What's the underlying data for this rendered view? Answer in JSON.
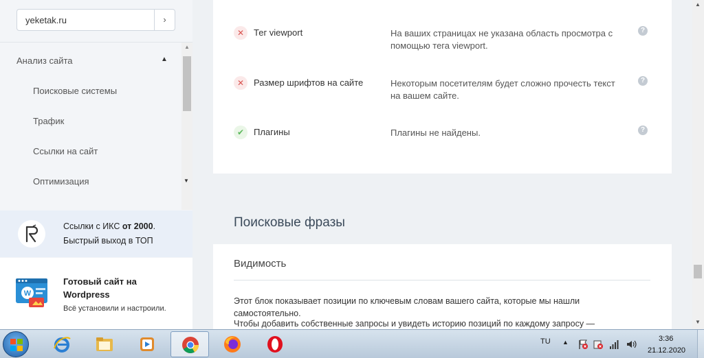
{
  "sidebar": {
    "site": "yeketak.ru",
    "go_symbol": "›",
    "nav": {
      "header": "Анализ сайта",
      "items": [
        "Поисковые системы",
        "Трафик",
        "Ссылки на сайт",
        "Оптимизация"
      ]
    },
    "promo1": {
      "line1_prefix": "Ссылки с ИКС ",
      "line1_strong": "от 2000",
      "line1_suffix": ".",
      "line2": "Быстрый выход в ТОП"
    },
    "promo2": {
      "title1": "Готовый сайт на",
      "title2": "Wordpress",
      "desc": "Всё установили и настроили."
    }
  },
  "checks": [
    {
      "status": "bad",
      "name": "Тег viewport",
      "desc": "На ваших страницах не указана область просмотра с помощью тега viewport."
    },
    {
      "status": "bad",
      "name": "Размер шрифтов на сайте",
      "desc": "Некоторым посетителям будет сложно прочесть текст на вашем сайте."
    },
    {
      "status": "ok",
      "name": "Плагины",
      "desc": "Плагины не найдены."
    }
  ],
  "search_phrases": {
    "title": "Поисковые фразы",
    "subtitle": "Видимость",
    "para1": "Этот блок показывает позиции по ключевым словам вашего сайта, которые мы нашли самостоятельно.",
    "para2": "Чтобы добавить собственные запросы и увидеть историю позиций по каждому запросу —"
  },
  "taskbar": {
    "lang": "TU",
    "time": "3:36",
    "date": "21.12.2020"
  },
  "colors": {
    "bad": "#d9534f",
    "ok": "#5cb85c",
    "accent": "#3b4a5a"
  }
}
